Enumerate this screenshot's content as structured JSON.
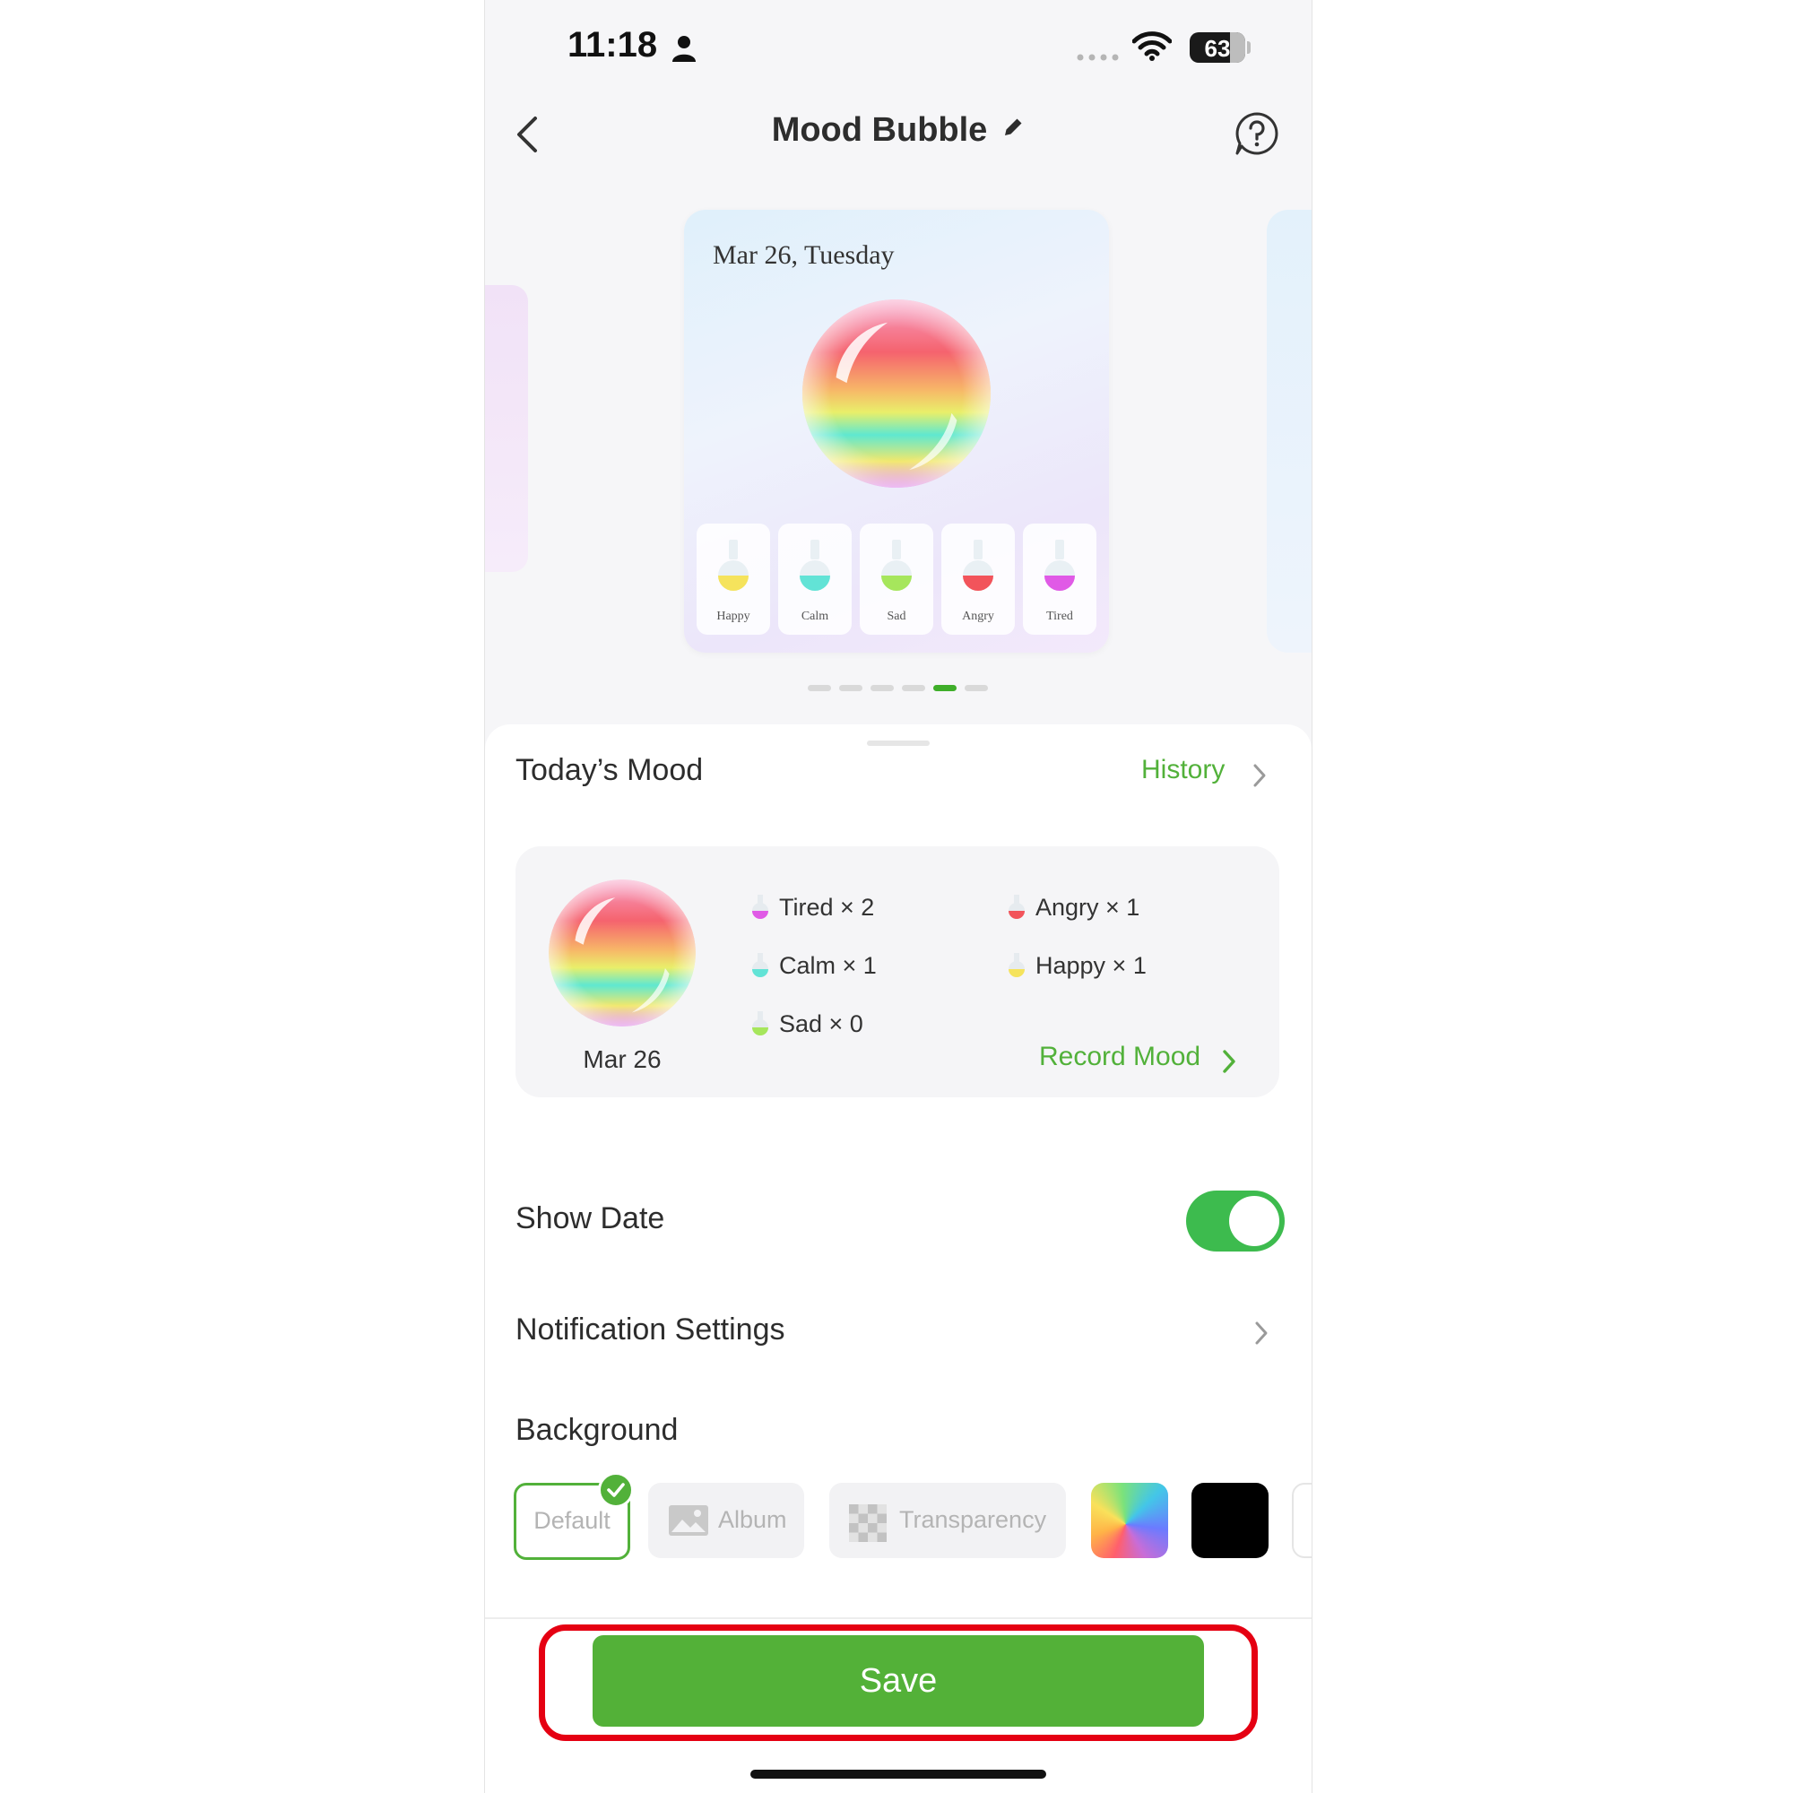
{
  "status_bar": {
    "time": "11:18",
    "battery": "63"
  },
  "header": {
    "title": "Mood Bubble"
  },
  "preview_card": {
    "date": "Mar 26, Tuesday",
    "bottles": [
      {
        "label": "Happy",
        "color": "#f5e35c"
      },
      {
        "label": "Calm",
        "color": "#62e3d6"
      },
      {
        "label": "Sad",
        "color": "#a6e65c"
      },
      {
        "label": "Angry",
        "color": "#f2545b"
      },
      {
        "label": "Tired",
        "color": "#e05ae6"
      }
    ]
  },
  "carousel": {
    "count": 6,
    "active_index": 4
  },
  "todays_mood": {
    "title": "Today’s Mood",
    "history_label": "History",
    "date": "Mar 26",
    "stats": [
      {
        "label": "Tired × 2",
        "color": "#e05ae6"
      },
      {
        "label": "Angry × 1",
        "color": "#f2545b"
      },
      {
        "label": "Calm × 1",
        "color": "#62e3d6"
      },
      {
        "label": "Happy × 1",
        "color": "#f5e35c"
      },
      {
        "label": "Sad × 0",
        "color": "#a6e65c"
      }
    ],
    "record_label": "Record Mood"
  },
  "settings": {
    "show_date_label": "Show Date",
    "show_date_on": true,
    "notification_label": "Notification Settings",
    "background_label": "Background",
    "background_options": {
      "default": "Default",
      "album": "Album",
      "transparency": "Transparency"
    },
    "selected_background": "default"
  },
  "save_label": "Save",
  "colors": {
    "accent": "#52b13a",
    "toggle": "#3dbb4e",
    "highlight": "#e50012"
  }
}
